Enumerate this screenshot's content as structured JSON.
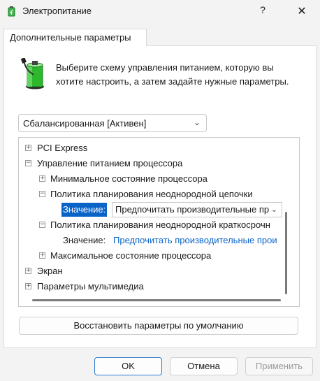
{
  "window": {
    "title": "Электропитание",
    "help": "?",
    "close": "✕"
  },
  "tab": {
    "label": "Дополнительные параметры"
  },
  "description": "Выберите схему управления питанием, которую вы хотите настроить, а затем задайте нужные параметры.",
  "scheme": {
    "selected": "Сбалансированная [Активен]"
  },
  "tree": {
    "items": [
      {
        "label": "PCI Express",
        "expander": "+"
      },
      {
        "label": "Управление питанием процессора",
        "expander": "−"
      },
      {
        "label": "Минимальное состояние процессора",
        "expander": "+"
      },
      {
        "label": "Политика планирования неоднородной цепочки",
        "expander": "−"
      },
      {
        "value_label": "Значение:",
        "value": "Предпочитать производительные пр"
      },
      {
        "label": "Политика планирования неоднородной краткосрочн",
        "expander": "−"
      },
      {
        "value_label": "Значение:",
        "value": "Предпочитать производительные прои"
      },
      {
        "label": "Максимальное состояние процессора",
        "expander": "+"
      },
      {
        "label": "Экран",
        "expander": "+"
      },
      {
        "label": "Параметры мультимедиа",
        "expander": "+"
      }
    ]
  },
  "buttons": {
    "restore": "Восстановить параметры по умолчанию",
    "ok": "OK",
    "cancel": "Отмена",
    "apply": "Применить"
  },
  "colors": {
    "accent": "#0a64c8",
    "battery": "#2eb82e"
  }
}
